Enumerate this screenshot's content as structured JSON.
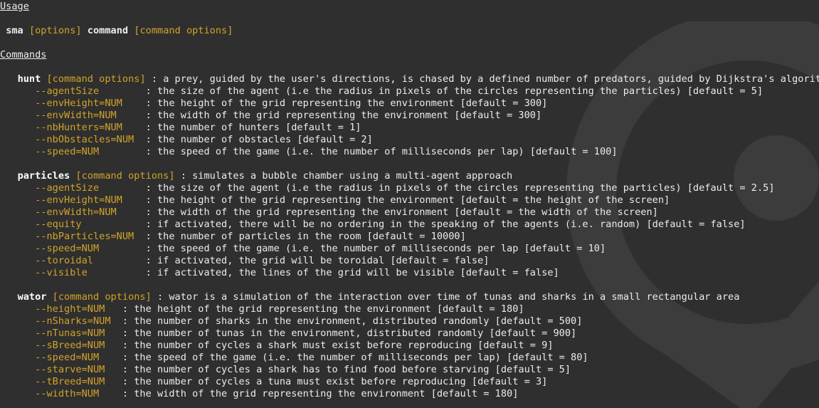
{
  "headings": {
    "usage": "Usage",
    "commands": "Commands"
  },
  "usage_line": {
    "prog": "sma",
    "options": "[options]",
    "command": "command",
    "command_options": "[command options]"
  },
  "commands": [
    {
      "name": "hunt",
      "options_label": "[command options]",
      "description": " : a prey, guided by the user's directions, is chased by a defined number of predators, guided by Dijkstra's algorithm",
      "flags": [
        {
          "flag": "--agentSize       ",
          "desc": " : the size of the agent (i.e the radius in pixels of the circles representing the particles) [default = 5]"
        },
        {
          "flag": "--envHeight=NUM   ",
          "desc": " : the height of the grid representing the environment [default = 300]"
        },
        {
          "flag": "--envWidth=NUM    ",
          "desc": " : the width of the grid representing the environment [default = 300]"
        },
        {
          "flag": "--nbHunters=NUM   ",
          "desc": " : the number of hunters [default = 1]"
        },
        {
          "flag": "--nbObstacles=NUM ",
          "desc": " : the number of obstacles [default = 2]"
        },
        {
          "flag": "--speed=NUM       ",
          "desc": " : the speed of the game (i.e. the number of milliseconds per lap) [default = 100]"
        }
      ]
    },
    {
      "name": "particles",
      "options_label": "[command options]",
      "description": " : simulates a bubble chamber using a multi-agent approach",
      "flags": [
        {
          "flag": "--agentSize       ",
          "desc": " : the size of the agent (i.e the radius in pixels of the circles representing the particles) [default = 2.5]"
        },
        {
          "flag": "--envHeight=NUM   ",
          "desc": " : the height of the grid representing the environment [default = the height of the screen]"
        },
        {
          "flag": "--envWidth=NUM    ",
          "desc": " : the width of the grid representing the environment [default = the width of the screen]"
        },
        {
          "flag": "--equity          ",
          "desc": " : if activated, there will be no ordering in the speaking of the agents (i.e. random) [default = false]"
        },
        {
          "flag": "--nbParticles=NUM ",
          "desc": " : the number of particles in the room [default = 10000]"
        },
        {
          "flag": "--speed=NUM       ",
          "desc": " : the speed of the game (i.e. the number of milliseconds per lap [default = 10]"
        },
        {
          "flag": "--toroidal        ",
          "desc": " : if activated, the grid will be toroidal [default = false]"
        },
        {
          "flag": "--visible         ",
          "desc": " : if activated, the lines of the grid will be visible [default = false]"
        }
      ]
    },
    {
      "name": "wator",
      "options_label": "[command options]",
      "description": " : wator is a simulation of the interaction over time of tunas and sharks in a small rectangular area",
      "flags": [
        {
          "flag": "--height=NUM  ",
          "desc": " : the height of the grid representing the environment [default = 180]"
        },
        {
          "flag": "--nSharks=NUM ",
          "desc": " : the number of sharks in the environment, distributed randomly [default = 500]"
        },
        {
          "flag": "--nTunas=NUM  ",
          "desc": " : the number of tunas in the environment, distributed randomly [default = 900]"
        },
        {
          "flag": "--sBreed=NUM  ",
          "desc": " : the number of cycles a shark must exist before reproducing [default = 9]"
        },
        {
          "flag": "--speed=NUM   ",
          "desc": " : the speed of the game (i.e. the number of milliseconds per lap) [default = 80]"
        },
        {
          "flag": "--starve=NUM  ",
          "desc": " : the number of cycles a shark has to find food before starving [default = 5]"
        },
        {
          "flag": "--tBreed=NUM  ",
          "desc": " : the number of cycles a tuna must exist before reproducing [default = 3]"
        },
        {
          "flag": "--width=NUM   ",
          "desc": " : the width of the grid representing the environment [default = 180]"
        }
      ]
    }
  ],
  "colors": {
    "background": "#2f2f2f",
    "text": "#ececec",
    "option": "#d1a32a"
  },
  "icons": {
    "background": "watermark-logo-icon"
  }
}
